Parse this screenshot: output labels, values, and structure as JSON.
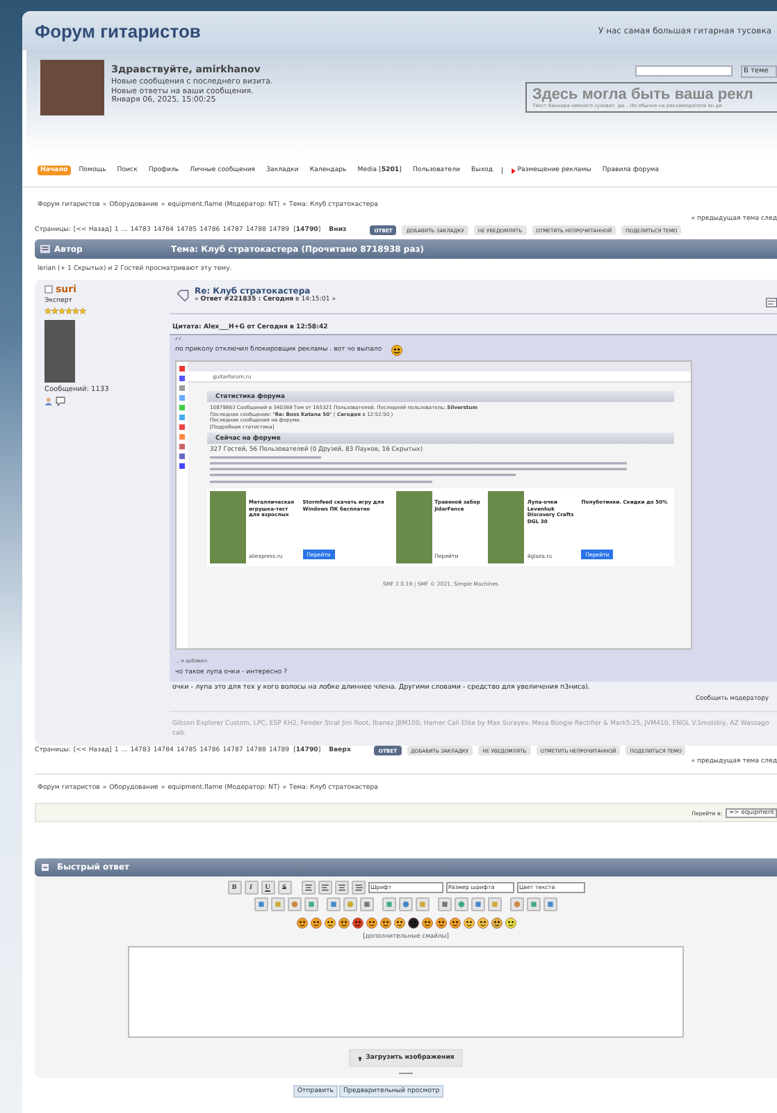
{
  "site": {
    "title": "Форум гитаристов",
    "tagline": "У нас самая большая гитарная тусовка"
  },
  "user": {
    "greeting": "Здравствуйте, amirkhanov",
    "lines": [
      "Новые сообщения с последнего визита.",
      "Новые ответы на ваши сообщения.",
      "Января 06, 2025, 15:00:25"
    ]
  },
  "search": {
    "scope": "В теме"
  },
  "banner": {
    "title": "Здесь могла быть ваша рекл",
    "text": "Текст баннера немного суховат, да... Но обычно на рекламодателя он де"
  },
  "menu": [
    {
      "kind": "link",
      "label": "Начало",
      "selected": true
    },
    {
      "kind": "link",
      "label": "Помощь",
      "selected": false
    },
    {
      "kind": "link",
      "label": "Поиск",
      "selected": false
    },
    {
      "kind": "link",
      "label": "Профиль",
      "selected": false
    },
    {
      "kind": "link",
      "label": "Личные сообщения",
      "selected": false
    },
    {
      "kind": "link",
      "label": "Закладки",
      "selected": false
    },
    {
      "kind": "link",
      "label": "Календарь",
      "selected": false
    },
    {
      "kind": "link",
      "label": "Media [**5201**]",
      "selected": false
    },
    {
      "kind": "link",
      "label": "Пользователи",
      "selected": false
    },
    {
      "kind": "link",
      "label": "Выход",
      "selected": false
    },
    {
      "kind": "separator",
      "label": "|"
    },
    {
      "kind": "promo",
      "label": "Размещение рекламы",
      "selected": false
    },
    {
      "kind": "link",
      "label": "Правила форума",
      "selected": false
    }
  ],
  "breadcrumbs_top": {
    "separator": "»",
    "items": [
      "Форум гитаристов",
      "Оборудование",
      "equipment.flame (Модератор: NT)",
      "Тема: Клуб стратокастера"
    ]
  },
  "topic_nav": "« предыдущая тема след",
  "pager_top": {
    "label": "Страницы:",
    "prev": "[<< Назад]",
    "pages": [
      "1",
      "...",
      "14783",
      "14784",
      "14785",
      "14786",
      "14787",
      "14788",
      "14789"
    ],
    "current": "[**14790**]",
    "jump": "Вниз"
  },
  "actions_top": [
    {
      "label": "ОТВЕТ",
      "primary": true
    },
    {
      "label": "ДОБАВИТЬ ЗАКЛАДКУ",
      "primary": false
    },
    {
      "label": "НЕ УВЕДОМЛЯТЬ",
      "primary": false
    },
    {
      "label": "ОТМЕТИТЬ НЕПРОЧИТАННОЙ",
      "primary": false
    },
    {
      "label": "ПОДЕЛИТЬСЯ ТЕМО",
      "primary": false
    }
  ],
  "topic_header": {
    "author": "Автор",
    "title": "Тема: Клуб стратокастера  (Прочитано 8718938 раз)"
  },
  "viewers": "lerian (+ 1 Скрытых) и 2 Гостей просматривают эту тему.",
  "post": {
    "author": "suri",
    "online": false,
    "rank": "Эксперт",
    "stars": 6,
    "posts": "Сообщений: 1133",
    "title": "Re: Клуб стратокастера",
    "meta": "« **Ответ #221835 : Сегодня** в 14:15:01 »",
    "quote_header": "Цитата: Alex___H+G от Сегодня в 12:58:42",
    "quote_text": "по приколу отключил блокировщик рекламы . вот чо выпало",
    "screenshot": {
      "address": "guitarforum.ru",
      "stats_title": "Статистика форума",
      "stats_lines": [
        "10879863 Сообщений в 340369 Тем от 165321 Пользователей. Последний пользователь: **Silverstum**",
        "Последнее сообщение: \"**Re: Boss Katana 50**\" ( **Сегодня** в 12:52:50 )",
        "Последние сообщения на форуме.",
        "[Подробная статистика]"
      ],
      "online_title": "Сейчас на форуме",
      "online_summary": "327 Гостей, 56 Пользователей (0 Друзей, 83 Пауков, 16 Скрытых)",
      "ads": [
        {
          "kind": "photo",
          "title": "Металлическая игрушка-тест для взрослых",
          "footer": "aliexpress.ru"
        },
        {
          "kind": "button",
          "title": "Stormfeed скачать игру для Windows ПК бесплатно",
          "footer": "Перейти"
        },
        {
          "kind": "photo",
          "title": "Травяной забор JidarFence",
          "footer": "Перейти"
        },
        {
          "kind": "photo",
          "title": "Лупа-очки Levenhuk Discovery Crafts DGL 30",
          "footer": "4glaza.ru"
        },
        {
          "kind": "button",
          "title": "Полуботинки. Скидки до 50%",
          "footer": "Перейти"
        }
      ],
      "footer": "SMF 2.0.19 | SMF © 2021, Simple Machines"
    },
    "quote_added": "... и добавил:",
    "quote_text2": "чо такое лупа очки - интересно ?",
    "body": "очки - лупа это для тех у кого волосы на лобке длиннее члена. Другими словами - средство для увеличения п3ниса).",
    "report": "Сообщить модератору",
    "signature": "Gibson Explorer Custom, LPC, ESP KH2, Fender Strat Jim Root, Ibanez JBM100, Hamer Cali Elite by Max Surayev. Mesa Boogie Rectifier & Mark5:25, JVM410, ENGL V.Smolskiy, AZ Wassago cab."
  },
  "pager_bottom": {
    "label": "Страницы:",
    "prev": "[<< Назад]",
    "pages": [
      "1",
      "...",
      "14783",
      "14784",
      "14785",
      "14786",
      "14787",
      "14788",
      "14789"
    ],
    "current": "[**14790**]",
    "jump": "Вверх"
  },
  "actions_bottom": [
    {
      "label": "ОТВЕТ",
      "primary": true
    },
    {
      "label": "ДОБАВИТЬ ЗАКЛАДКУ",
      "primary": false
    },
    {
      "label": "НЕ УВЕДОМЛЯТЬ",
      "primary": false
    },
    {
      "label": "ОТМЕТИТЬ НЕПРОЧИТАННОЙ",
      "primary": false
    },
    {
      "label": "ПОДЕЛИТЬСЯ ТЕМО",
      "primary": false
    }
  ],
  "topic_nav_bottom": "« предыдущая тема след",
  "breadcrumbs_bottom": {
    "separator": "»",
    "items": [
      "Форум гитаристов",
      "Оборудование",
      "equipment.flame (Модератор: NT)",
      "Тема: Клуб стратокастера"
    ]
  },
  "jump": {
    "label": "Перейти в:",
    "value": "=> equipment"
  },
  "quick_reply": {
    "title": "Быстрый ответ",
    "format_buttons": [
      "B",
      "I",
      "U",
      "S"
    ],
    "font": "Шрифт",
    "size": "Размер шрифта",
    "text_color": "Цвет текста",
    "more_smileys": "[дополнительные смайлы]",
    "upload": "Загрузить изображения",
    "submit": "Отправить",
    "preview": "Предварительный просмотр"
  }
}
